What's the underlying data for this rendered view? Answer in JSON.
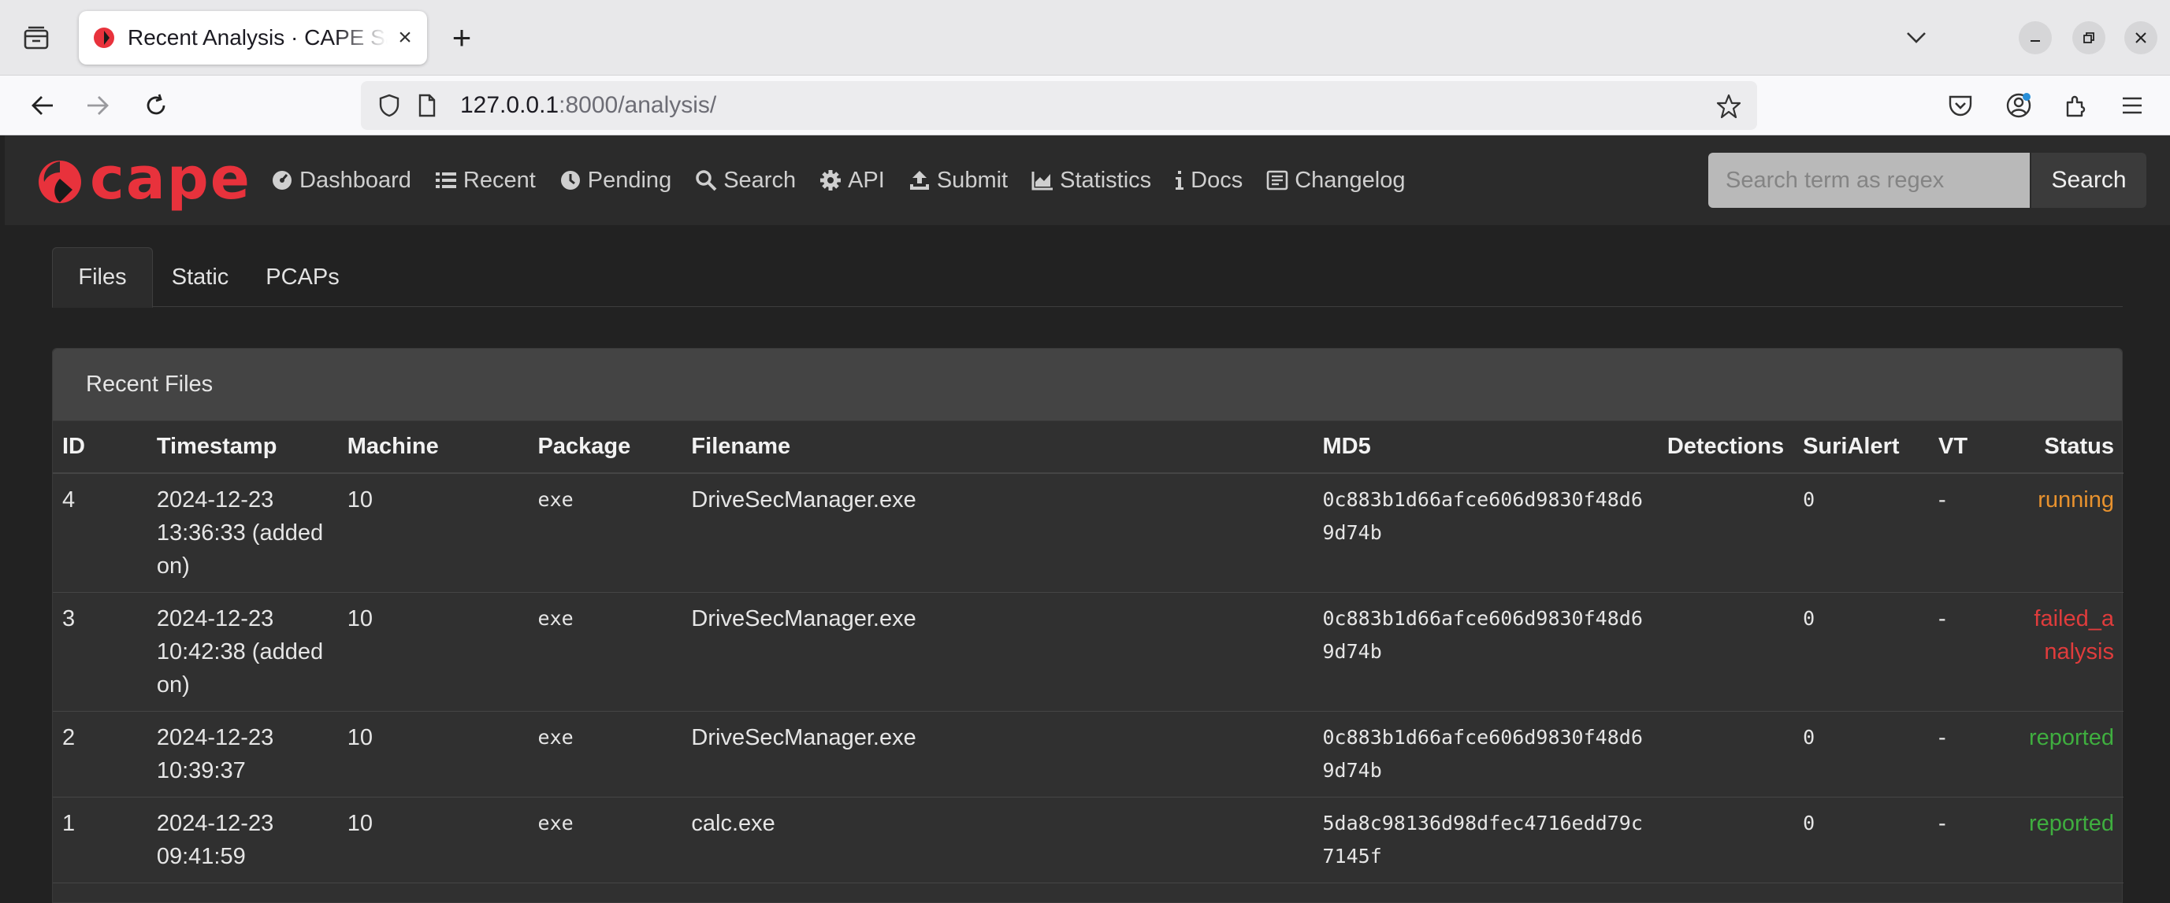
{
  "browser": {
    "tab_title": "Recent Analysis · CAPE Sandbox",
    "url_host": "127.0.0.1",
    "url_rest": ":8000/analysis/"
  },
  "cape": {
    "logo_text": "cape",
    "menu": [
      {
        "label": "Dashboard",
        "icon": "dashboard-icon"
      },
      {
        "label": "Recent",
        "icon": "list-icon"
      },
      {
        "label": "Pending",
        "icon": "clock-icon"
      },
      {
        "label": "Search",
        "icon": "search-icon"
      },
      {
        "label": "API",
        "icon": "gear-icon"
      },
      {
        "label": "Submit",
        "icon": "upload-icon"
      },
      {
        "label": "Statistics",
        "icon": "chart-icon"
      },
      {
        "label": "Docs",
        "icon": "info-icon"
      },
      {
        "label": "Changelog",
        "icon": "changelog-icon"
      }
    ],
    "search_placeholder": "Search term as regex",
    "search_button": "Search"
  },
  "subtabs": [
    "Files",
    "Static",
    "PCAPs"
  ],
  "card_title": "Recent Files",
  "columns": [
    "ID",
    "Timestamp",
    "Machine",
    "Package",
    "Filename",
    "MD5",
    "Detections",
    "SuriAlert",
    "VT",
    "Status"
  ],
  "rows": [
    {
      "id": "4",
      "timestamp": "2024-12-23 13:36:33 (added on)",
      "machine": "10",
      "package": "exe",
      "filename": "DriveSecManager.exe",
      "md5": "0c883b1d66afce606d9830f48d69d74b",
      "detections": "",
      "surialert": "0",
      "vt": "-",
      "status": "running",
      "status_color": "#e8922e"
    },
    {
      "id": "3",
      "timestamp": "2024-12-23 10:42:38 (added on)",
      "machine": "10",
      "package": "exe",
      "filename": "DriveSecManager.exe",
      "md5": "0c883b1d66afce606d9830f48d69d74b",
      "detections": "",
      "surialert": "0",
      "vt": "-",
      "status": "failed_analysis",
      "status_color": "#e03c3c"
    },
    {
      "id": "2",
      "timestamp": "2024-12-23 10:39:37",
      "machine": "10",
      "package": "exe",
      "filename": "DriveSecManager.exe",
      "md5": "0c883b1d66afce606d9830f48d69d74b",
      "detections": "",
      "surialert": "0",
      "vt": "-",
      "status": "reported",
      "status_color": "#3fae3f"
    },
    {
      "id": "1",
      "timestamp": "2024-12-23 09:41:59",
      "machine": "10",
      "package": "exe",
      "filename": "calc.exe",
      "md5": "5da8c98136d98dfec4716edd79c7145f",
      "detections": "",
      "surialert": "0",
      "vt": "-",
      "status": "reported",
      "status_color": "#3fae3f"
    }
  ]
}
